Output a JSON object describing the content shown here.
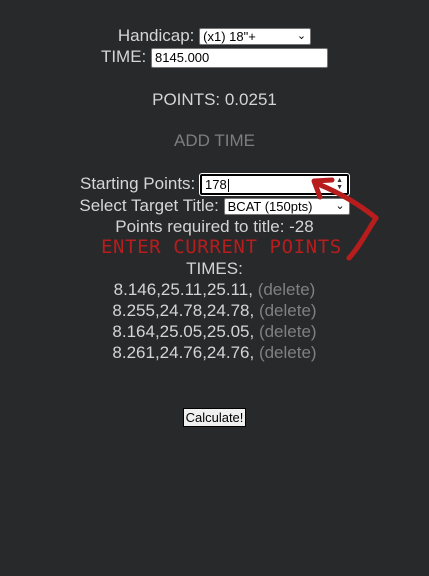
{
  "handicap": {
    "label": "Handicap:",
    "selected": "(x1) 18\"+"
  },
  "time": {
    "label": "TIME:",
    "value": "8145.000"
  },
  "points": {
    "text": "POINTS: 0.0251"
  },
  "add_time": {
    "label": "ADD TIME"
  },
  "starting_points": {
    "label": "Starting Points:",
    "value": "178"
  },
  "target_title": {
    "label": "Select Target Title:",
    "selected": "BCAT (150pts)"
  },
  "points_required": {
    "text": "Points required to title: -28"
  },
  "annotation": {
    "text": "ENTER CURRENT POINTS",
    "color": "#b81d1d"
  },
  "times": {
    "header": "TIMES:",
    "entries": [
      {
        "value": "8.146,25.11,25.11,",
        "delete_label": "(delete)"
      },
      {
        "value": "8.255,24.78,24.78,",
        "delete_label": "(delete)"
      },
      {
        "value": "8.164,25.05,25.05,",
        "delete_label": "(delete)"
      },
      {
        "value": "8.261,24.76,24.76,",
        "delete_label": "(delete)"
      }
    ]
  },
  "calculate": {
    "label": "Calculate!"
  },
  "colors": {
    "background": "#28292b",
    "text": "#d4d4d4",
    "muted": "#808080",
    "annotation_red": "#b81d1d"
  }
}
